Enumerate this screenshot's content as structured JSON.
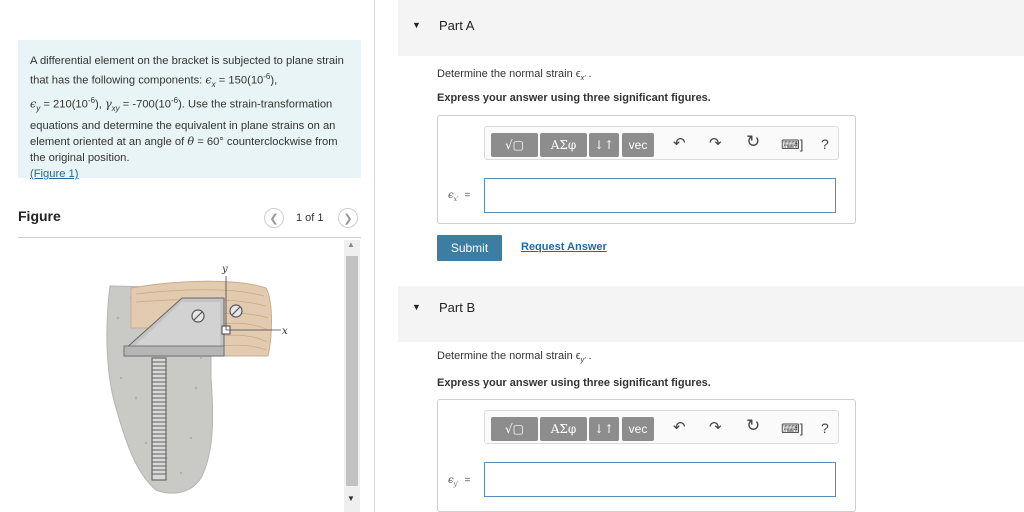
{
  "problem": {
    "intro": "A differential element on the bracket is subjected to plane strain that has the following components: ",
    "ex_symbol": "ϵ",
    "ex_sub": "x",
    "ex_value": " = 150(10",
    "exp": "-6",
    "close_comma": "),",
    "ey_symbol": "ϵ",
    "ey_sub": "y",
    "ey_value": " = 210(10",
    "gxy_symbol": "γ",
    "gxy_sub": "xy",
    "gxy_value": " = -700(10",
    "after_gxy": "). Use the strain-transformation equations and determine the equivalent in plane strains on an element oriented at an angle of ",
    "theta_text": "θ",
    "theta_value": " = 60°",
    "tail": " counterclockwise from the original position.",
    "figure_link": "(Figure 1)"
  },
  "figure_panel": {
    "title": "Figure",
    "prev_icon": "chevron-left-icon",
    "next_icon": "chevron-right-icon",
    "counter": "1 of 1",
    "axis_y": "y",
    "axis_x": "x"
  },
  "part_a": {
    "title": "Part A",
    "question": "Determine the normal strain ϵ",
    "question_sub": "x′",
    "question_end": " .",
    "instruction": "Express your answer using three significant figures.",
    "var_symbol": "ϵ",
    "var_sub": "x′",
    "equals": "=",
    "input_value": ""
  },
  "part_b": {
    "title": "Part B",
    "question": "Determine the normal strain ϵ",
    "question_sub": "y′",
    "question_end": " .",
    "instruction": "Express your answer using three significant figures.",
    "var_symbol": "ϵ",
    "var_sub": "y′",
    "equals": "=",
    "input_value": ""
  },
  "toolbar": {
    "templates_label": "√▢",
    "symbols_label": "ΑΣφ",
    "updown_label": "↓↑",
    "vec_label": "vec",
    "undo_icon": "undo-icon",
    "redo_icon": "redo-icon",
    "reset_icon": "reset-icon",
    "keyboard_icon": "keyboard-icon",
    "help_label": "?"
  },
  "actions": {
    "submit_label": "Submit",
    "request_label": "Request Answer"
  },
  "colors": {
    "problem_bg": "#e9f4f6",
    "submit_bg": "#3c7ea1",
    "link": "#2468a8",
    "part_header_bg": "#f4f4f4"
  }
}
